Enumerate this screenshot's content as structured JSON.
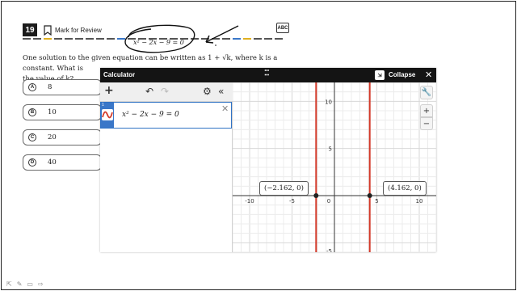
{
  "question": {
    "number": "19",
    "mark_label": "Mark for Review",
    "abc_label": "ABC",
    "annotation_equation": "x² − 2x − 9 = 0",
    "text_line1": "One solution to the given equation can be written as 1 + √k, where k is a constant. What is",
    "text_line2": "the value of k?",
    "choices": [
      {
        "letter": "A",
        "value": "8"
      },
      {
        "letter": "B",
        "value": "10"
      },
      {
        "letter": "C",
        "value": "20"
      },
      {
        "letter": "D",
        "value": "40"
      }
    ]
  },
  "calculator": {
    "title": "Calculator",
    "collapse_label": "Collapse",
    "expression_index": "1",
    "expression": "x² − 2x − 9 = 0",
    "zoom_in": "+",
    "zoom_out": "−",
    "point_left": "(−2.162, 0)",
    "point_right": "(4.162, 0)",
    "x_ticks": [
      "-10",
      "-5",
      "0",
      "5",
      "10"
    ],
    "y_ticks": [
      "10",
      "5"
    ],
    "y_bottom_tick": "-5",
    "roots": [
      -2.162,
      4.162
    ],
    "x_range": [
      -12,
      12
    ],
    "y_range": [
      -6,
      12
    ],
    "line_color": "#d33a2a",
    "accent_color": "#3a77c8"
  }
}
